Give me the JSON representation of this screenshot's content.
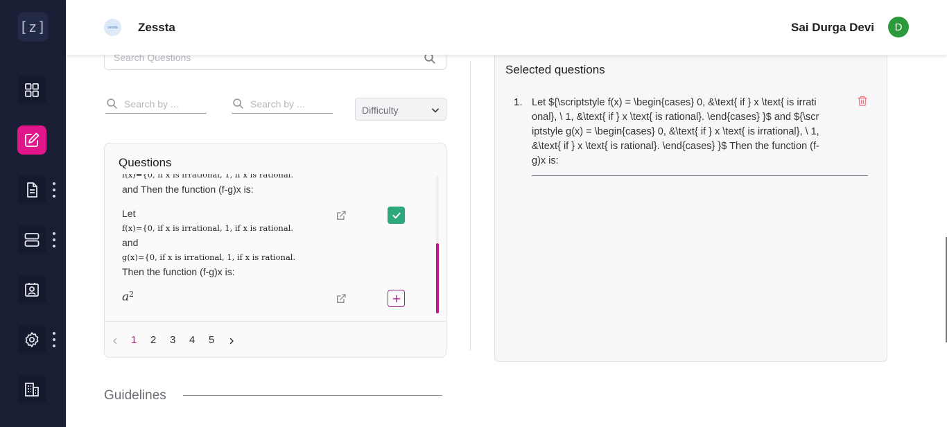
{
  "app": {
    "logo_text": "[z]",
    "brand_logo_text": "zessta",
    "brand_name": "Zessta",
    "user_name": "Sai Durga Devi",
    "user_initial": "D"
  },
  "sidebar": {
    "items": [
      {
        "icon": "grid-icon",
        "active": false,
        "has_menu": false
      },
      {
        "icon": "edit-icon",
        "active": true,
        "has_menu": false
      },
      {
        "icon": "document-icon",
        "active": false,
        "has_menu": true
      },
      {
        "icon": "server-icon",
        "active": false,
        "has_menu": true
      },
      {
        "icon": "id-card-icon",
        "active": false,
        "has_menu": false
      },
      {
        "icon": "settings-icon",
        "active": false,
        "has_menu": true
      },
      {
        "icon": "building-icon",
        "active": false,
        "has_menu": false
      }
    ],
    "accent_color": "#e0168a"
  },
  "search": {
    "placeholder": "Search Questions"
  },
  "filters": {
    "filter1_placeholder": "Search by ...",
    "filter2_placeholder": "Search by ...",
    "difficulty_label": "Difficulty"
  },
  "questions": {
    "title": "Questions",
    "partial_top_math": "f(x)={0,    if x is irrational, 1,    if x is rational.",
    "partial_top_text": "and Then the function (f-g)x is:",
    "item1": {
      "line1": "Let",
      "f_math": "f(x)={0,    if x is irrational, 1,    if x is rational.",
      "line2": "and",
      "g_math": "g(x)={0,    if x is irrational, 1,    if x is rational.",
      "line3": "Then the function (f-g)x is:",
      "selected": true
    },
    "item2": {
      "math": "a",
      "exponent": "2",
      "selected": false
    }
  },
  "pagination": {
    "pages": [
      "1",
      "2",
      "3",
      "4",
      "5"
    ],
    "current": "1"
  },
  "selected": {
    "title": "Selected questions",
    "items": [
      {
        "number": "1.",
        "text": "Let ${\\scriptstyle f(x) = \\begin{cases} 0, &\\text{ if } x \\text{ is irrational}, \\ 1, &\\text{ if } x \\text{ is rational}. \\end{cases} }$ and ${\\scriptstyle g(x) = \\begin{cases} 0, &\\text{ if } x \\text{ is irrational}, \\ 1, &\\text{ if } x \\text{ is rational}. \\end{cases} }$ Then the function (f-g)x is:"
      }
    ]
  },
  "guidelines": {
    "title": "Guidelines"
  }
}
